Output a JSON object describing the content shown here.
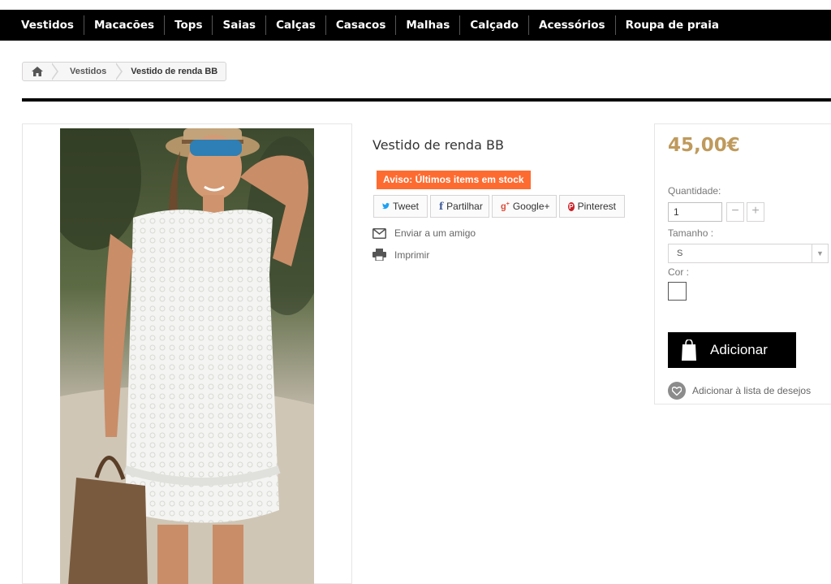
{
  "nav": {
    "items": [
      "Vestidos",
      "Macacões",
      "Tops",
      "Saias",
      "Calças",
      "Casacos",
      "Malhas",
      "Calçado",
      "Acessórios",
      "Roupa de praia"
    ]
  },
  "breadcrumb": {
    "home_icon": "home-icon",
    "items": [
      "Vestidos"
    ],
    "current": "Vestido de renda BB"
  },
  "product": {
    "title": "Vestido de renda BB",
    "stock_warning": "Aviso: Últimos items em stock",
    "image_alt": "white lace dress photo"
  },
  "social": {
    "tweet": "Tweet",
    "share": "Partilhar",
    "google": "Google+",
    "pinterest": "Pinterest"
  },
  "actions": {
    "send_friend": "Enviar a um amigo",
    "print": "Imprimir"
  },
  "buy": {
    "price": "45,00€",
    "quantity_label": "Quantidade:",
    "quantity_value": "1",
    "size_label": "Tamanho :",
    "size_value": "S",
    "color_label": "Cor :",
    "add_button": "Adicionar",
    "wishlist": "Adicionar à lista de desejos"
  },
  "colors": {
    "nav_bg": "#000000",
    "stock_bg": "#fe6b31",
    "price": "#bf9a5c",
    "twitter": "#1da1f2",
    "facebook": "#3b5998",
    "google": "#dd4b39",
    "pinterest": "#cb2027"
  }
}
